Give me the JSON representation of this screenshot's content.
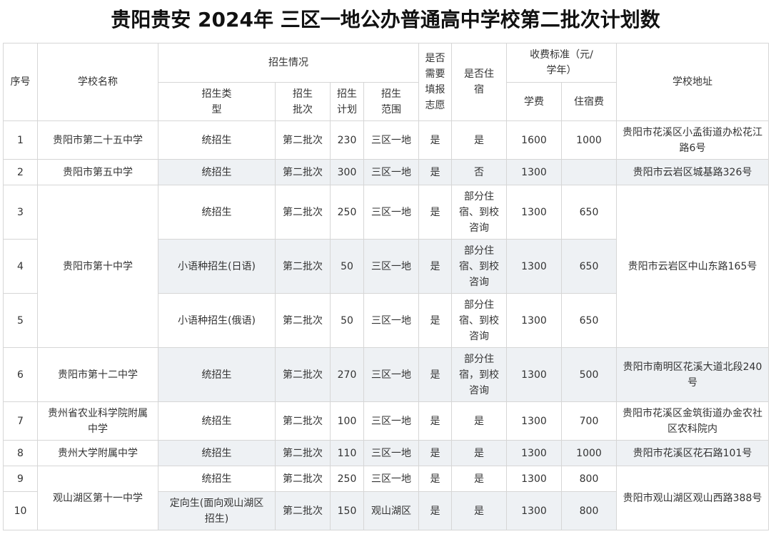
{
  "title": "贵阳贵安 2024年 三区一地公办普通高中学校第二批次计划数",
  "headers": {
    "seq": "序号",
    "school": "学校名称",
    "enroll_group": "招生情况",
    "need_volunteer": "是否需要填报志愿",
    "boarding": "是否住宿",
    "fee_group": "收费标准（元/学年）",
    "address": "学校地址",
    "type": "招生类型",
    "batch": "招生批次",
    "plan": "招生计划",
    "scope": "招生范围",
    "tuition": "学费",
    "dorm_fee": "住宿费"
  },
  "schools": [
    "贵阳市第二十五中学",
    "贵阳市第五中学",
    "贵阳市第十中学",
    "贵阳市第十二中学",
    "贵州省农业科学院附属中学",
    "贵州大学附属中学",
    "观山湖区第十一中学"
  ],
  "addresses": [
    "贵阳市花溪区小孟街道办松花江路6号",
    "贵阳市云岩区城基路326号",
    "贵阳市云岩区中山东路165号",
    "贵阳市南明区花溪大道北段240号",
    "贵阳市花溪区金筑街道办金农社区农科院内",
    "贵阳市花溪区花石路101号",
    "贵阳市观山湖区观山西路388号"
  ],
  "rows": [
    {
      "seq": "1",
      "type": "统招生",
      "batch": "第二批次",
      "plan": "230",
      "scope": "三区一地",
      "need": "是",
      "board": "是",
      "tuition": "1600",
      "dorm": "1000"
    },
    {
      "seq": "2",
      "type": "统招生",
      "batch": "第二批次",
      "plan": "300",
      "scope": "三区一地",
      "need": "是",
      "board": "否",
      "tuition": "1300",
      "dorm": ""
    },
    {
      "seq": "3",
      "type": "统招生",
      "batch": "第二批次",
      "plan": "250",
      "scope": "三区一地",
      "need": "是",
      "board": "部分住宿、到校咨询",
      "tuition": "1300",
      "dorm": "650"
    },
    {
      "seq": "4",
      "type": "小语种招生(日语)",
      "batch": "第二批次",
      "plan": "50",
      "scope": "三区一地",
      "need": "是",
      "board": "部分住宿、到校咨询",
      "tuition": "1300",
      "dorm": "650"
    },
    {
      "seq": "5",
      "type": "小语种招生(俄语)",
      "batch": "第二批次",
      "plan": "50",
      "scope": "三区一地",
      "need": "是",
      "board": "部分住宿、到校咨询",
      "tuition": "1300",
      "dorm": "650"
    },
    {
      "seq": "6",
      "type": "统招生",
      "batch": "第二批次",
      "plan": "270",
      "scope": "三区一地",
      "need": "是",
      "board": "部分住宿，到校咨询",
      "tuition": "1300",
      "dorm": "500"
    },
    {
      "seq": "7",
      "type": "统招生",
      "batch": "第二批次",
      "plan": "100",
      "scope": "三区一地",
      "need": "是",
      "board": "是",
      "tuition": "1300",
      "dorm": "700"
    },
    {
      "seq": "8",
      "type": "统招生",
      "batch": "第二批次",
      "plan": "110",
      "scope": "三区一地",
      "need": "是",
      "board": "是",
      "tuition": "1300",
      "dorm": "1000"
    },
    {
      "seq": "9",
      "type": "统招生",
      "batch": "第二批次",
      "plan": "250",
      "scope": "三区一地",
      "need": "是",
      "board": "是",
      "tuition": "1300",
      "dorm": "800"
    },
    {
      "seq": "10",
      "type": "定向生(面向观山湖区招生)",
      "batch": "第二批次",
      "plan": "150",
      "scope": "观山湖区",
      "need": "是",
      "board": "是",
      "tuition": "1300",
      "dorm": "800"
    }
  ]
}
